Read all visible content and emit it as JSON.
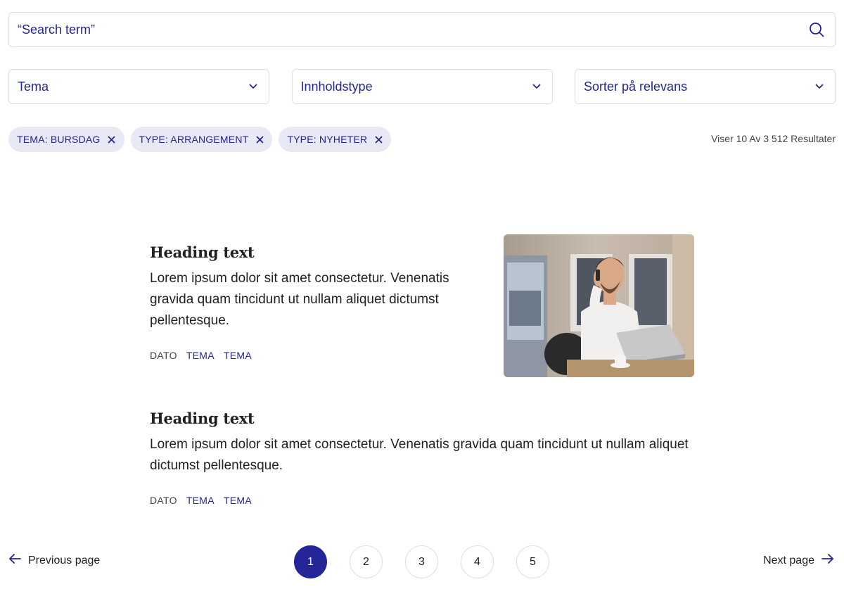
{
  "search": {
    "placeholder": "“Search term”",
    "icon": "search-icon"
  },
  "filters": [
    {
      "label": "Tema",
      "icon": "chevron-down-icon"
    },
    {
      "label": "Innholdstype",
      "icon": "chevron-down-icon"
    },
    {
      "label": "Sorter på relevans",
      "icon": "chevron-down-icon"
    }
  ],
  "chips": [
    {
      "label": "TEMA: BURSDAG"
    },
    {
      "label": "TYPE: ARRANGEMENT"
    },
    {
      "label": "TYPE: NYHETER"
    }
  ],
  "result_count": "Viser 10 Av 3 512 Resultater",
  "articles": [
    {
      "heading": "Heading text",
      "body": "Lorem ipsum dolor sit amet consectetur. Venenatis gravida quam tincidunt ut nullam aliquet dictumst pellentesque.",
      "date": "DATO",
      "tags": [
        "TEMA",
        "TEMA"
      ],
      "has_image": true
    },
    {
      "heading": "Heading text",
      "body": "Lorem ipsum dolor sit amet consectetur. Venenatis gravida quam tincidunt ut nullam aliquet dictumst pellentesque.",
      "date": "DATO",
      "tags": [
        "TEMA",
        "TEMA"
      ],
      "has_image": false
    }
  ],
  "pagination": {
    "prev_label": "Previous page",
    "next_label": "Next page",
    "pages": [
      "1",
      "2",
      "3",
      "4",
      "5"
    ],
    "current": "1"
  },
  "colors": {
    "accent": "#25259a",
    "chip_bg": "#e9e9f5",
    "border": "#dddde6"
  }
}
